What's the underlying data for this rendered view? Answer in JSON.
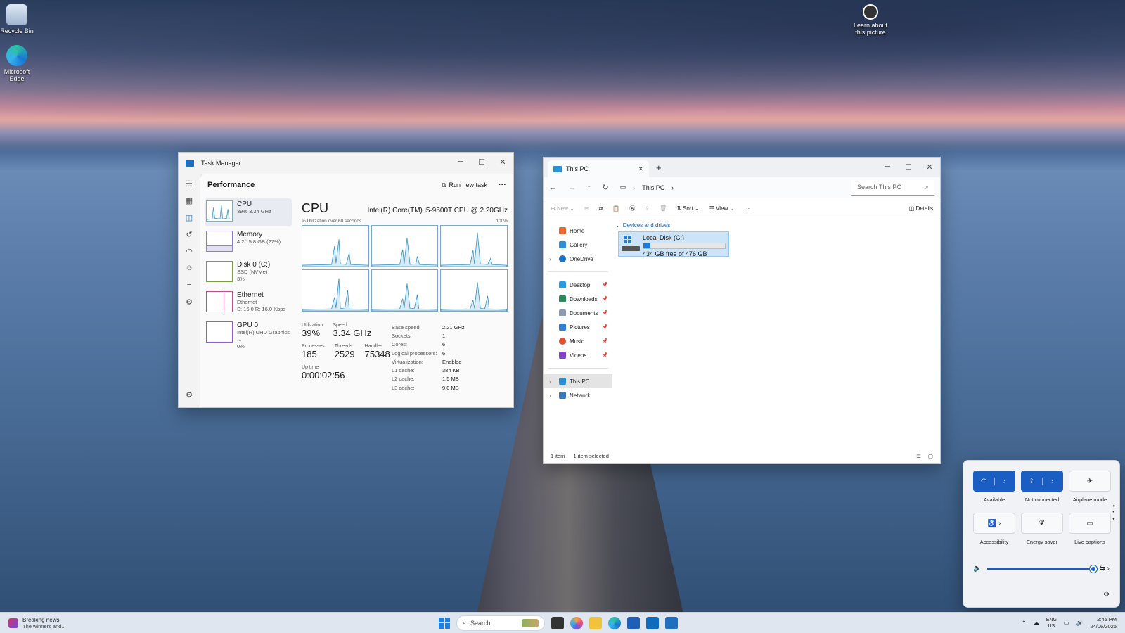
{
  "desktop": {
    "icons": [
      {
        "label": "Recycle Bin"
      },
      {
        "label": "Microsoft Edge"
      },
      {
        "label": "Learn about this picture"
      }
    ]
  },
  "task_manager": {
    "title": "Task Manager",
    "header": "Performance",
    "run_new_task": "Run new task",
    "more": "···",
    "resources": [
      {
        "name": "CPU",
        "sub1": "39% 3.34 GHz",
        "sub2": "",
        "sub3": ""
      },
      {
        "name": "Memory",
        "sub1": "4.2/15.8 GB (27%)",
        "sub2": "",
        "sub3": ""
      },
      {
        "name": "Disk 0 (C:)",
        "sub1": "SSD (NVMe)",
        "sub2": "3%",
        "sub3": ""
      },
      {
        "name": "Ethernet",
        "sub1": "Ethernet",
        "sub2": "S: 16.0  R: 16.0 Kbps",
        "sub3": ""
      },
      {
        "name": "GPU 0",
        "sub1": "Intel(R) UHD Graphics ...",
        "sub2": "0%",
        "sub3": ""
      }
    ],
    "detail": {
      "title": "CPU",
      "model": "Intel(R) Core(TM) i5-9500T CPU @ 2.20GHz",
      "graph_caption": "% Utilization over 60 seconds",
      "graph_max": "100%",
      "utilization_label": "Utilization",
      "utilization": "39%",
      "speed_label": "Speed",
      "speed": "3.34 GHz",
      "processes_label": "Processes",
      "processes": "185",
      "threads_label": "Threads",
      "threads": "2529",
      "handles_label": "Handles",
      "handles": "75348",
      "uptime_label": "Up time",
      "uptime": "0:00:02:56",
      "specs": [
        {
          "k": "Base speed:",
          "v": "2.21 GHz"
        },
        {
          "k": "Sockets:",
          "v": "1"
        },
        {
          "k": "Cores:",
          "v": "6"
        },
        {
          "k": "Logical processors:",
          "v": "6"
        },
        {
          "k": "Virtualization:",
          "v": "Enabled"
        },
        {
          "k": "L1 cache:",
          "v": "384 KB"
        },
        {
          "k": "L2 cache:",
          "v": "1.5 MB"
        },
        {
          "k": "L3 cache:",
          "v": "9.0 MB"
        }
      ]
    }
  },
  "explorer": {
    "tab_title": "This PC",
    "breadcrumb": "This PC",
    "search_placeholder": "Search This PC",
    "commands": {
      "new": "New",
      "sort": "Sort",
      "view": "View",
      "more": "···",
      "details": "Details"
    },
    "nav": [
      {
        "label": "Home"
      },
      {
        "label": "Gallery"
      },
      {
        "label": "OneDrive"
      },
      {
        "label": "Desktop"
      },
      {
        "label": "Downloads"
      },
      {
        "label": "Documents"
      },
      {
        "label": "Pictures"
      },
      {
        "label": "Music"
      },
      {
        "label": "Videos"
      },
      {
        "label": "This PC"
      },
      {
        "label": "Network"
      }
    ],
    "group_label": "Devices and drives",
    "drive": {
      "name": "Local Disk (C:)",
      "free": "434 GB free of 476 GB",
      "used_fraction": 0.088
    },
    "status": {
      "items": "1 item",
      "selected": "1 item selected"
    }
  },
  "quick_settings": {
    "tiles": [
      {
        "label": "Available"
      },
      {
        "label": "Not connected"
      },
      {
        "label": "Airplane mode"
      },
      {
        "label": "Accessibility"
      },
      {
        "label": "Energy saver"
      },
      {
        "label": "Live captions"
      }
    ],
    "volume": 1.0
  },
  "taskbar": {
    "news_title": "Breaking news",
    "news_sub": "The winners and...",
    "search_placeholder": "Search",
    "lang": "ENG",
    "region": "US",
    "time": "2:45 PM",
    "date": "24/06/2025"
  }
}
